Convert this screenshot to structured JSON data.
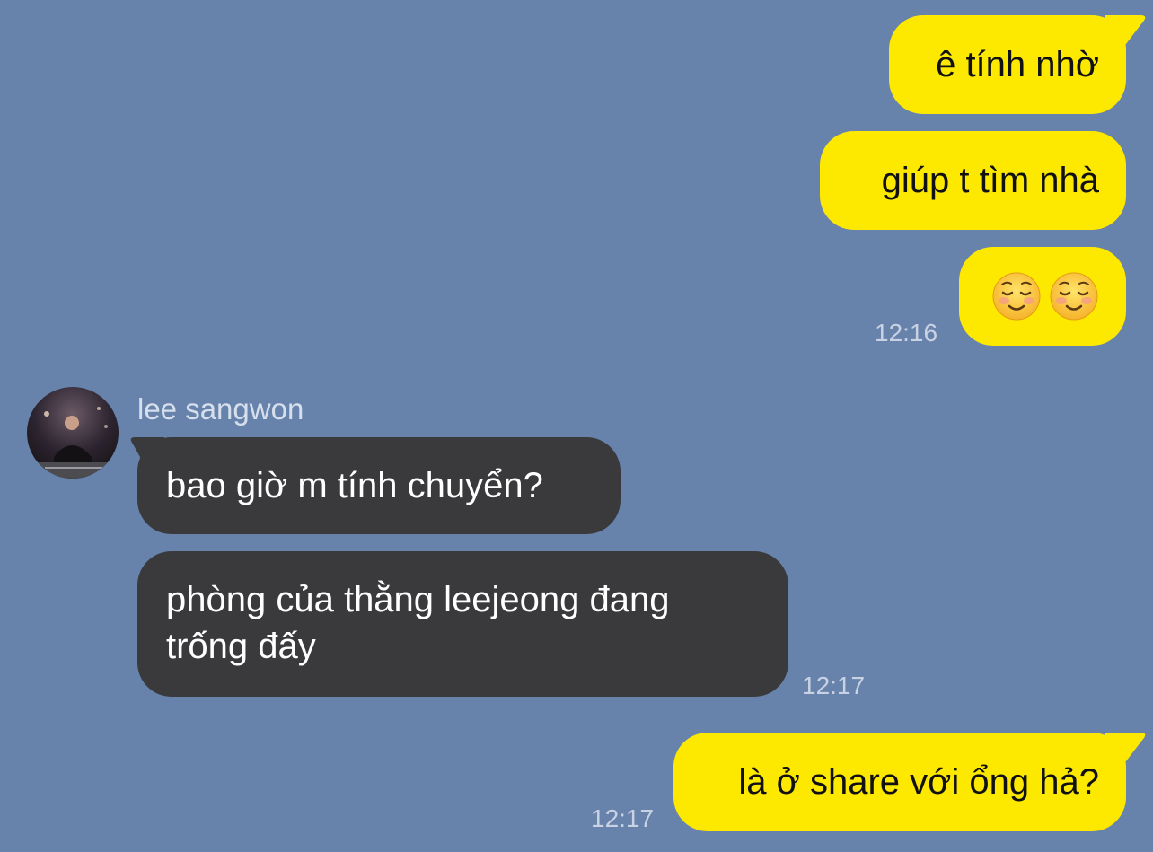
{
  "messages": [
    {
      "text": "ê tính nhờ"
    },
    {
      "text": "giúp t tìm nhà"
    },
    {
      "emoji": [
        "smiling-face",
        "smiling-face"
      ],
      "time": "12:16"
    },
    {
      "sender": "lee sangwon",
      "text": "bao giờ m tính chuyển?"
    },
    {
      "text": "phòng của thằng leejeong đang trống đấy",
      "time": "12:17"
    },
    {
      "text": "là ở share với ổng hả?",
      "time": "12:17"
    }
  ],
  "colors": {
    "background": "#6783ab",
    "outgoing_bubble": "#fde800",
    "incoming_bubble": "#3a3a3c"
  }
}
